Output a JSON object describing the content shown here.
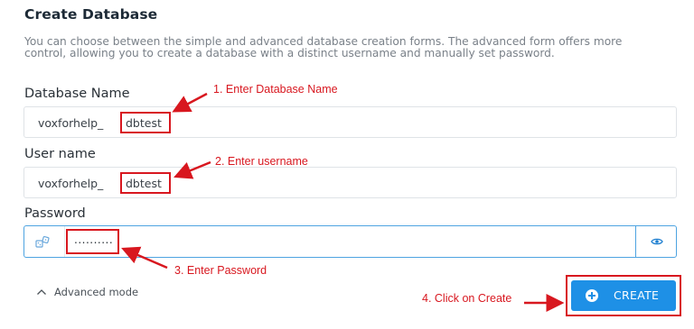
{
  "form": {
    "title": "Create Database",
    "description": "You can choose between the simple and advanced database creation forms. The advanced form offers more control, allowing you to create a database with a distinct username and manually set password.",
    "database_name": {
      "label": "Database Name",
      "prefix": "voxforhelp_",
      "value": "dbtest"
    },
    "user_name": {
      "label": "User name",
      "prefix": "voxforhelp_",
      "value": "dbtest"
    },
    "password": {
      "label": "Password",
      "masked_value": ".........."
    },
    "advanced_mode_label": "Advanced mode",
    "create_button_label": "CREATE"
  },
  "annotations": {
    "step1": "1. Enter Database Name",
    "step2": "2. Enter username",
    "step3": "3. Enter Password",
    "step4": "4. Click on Create"
  },
  "colors": {
    "accent": "#1e90e6",
    "annotation_red": "#d8171f",
    "focus_border": "#4ea4e1"
  },
  "icons": {
    "password_generator": "key-dice-icon",
    "show_password": "eye-icon",
    "advanced_toggle": "chevron-up-icon",
    "create": "plus-circle-icon"
  }
}
